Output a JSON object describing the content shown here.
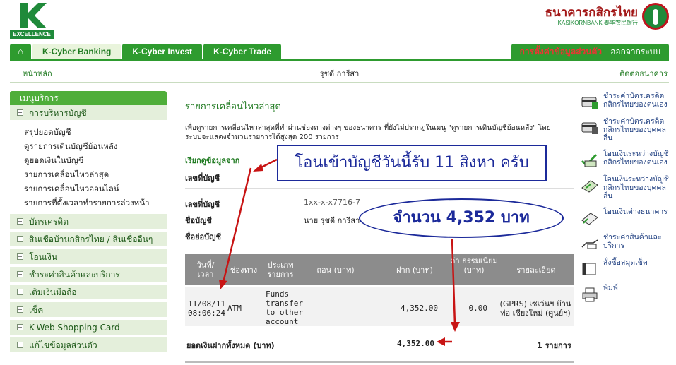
{
  "header": {
    "logo_text": "EXCELLENCE",
    "bank_name_thai": "ธนาคารกสิกรไทย",
    "bank_name_en": "KASIKORNBANK 泰华农民银行"
  },
  "tabs": [
    "K-Cyber Banking",
    "K-Cyber Invest",
    "K-Cyber Trade"
  ],
  "tab_right": {
    "settings": "การตั้งค่าข้อมูลส่วนตัว",
    "logout": "ออกจากระบบ"
  },
  "subnav": {
    "home": "หน้าหลัก",
    "user": "รุชดี การีสา",
    "contact": "ติดต่อธนาคาร"
  },
  "sidebar": {
    "title": "เมนูบริการ",
    "account_group": "การบริหารบัญชี",
    "account_items": [
      "สรุปยอดบัญชี",
      "ดูรายการเดินบัญชีย้อนหลัง",
      "ดูยอดเงินในบัญชี",
      "รายการเคลื่อนไหวล่าสุด",
      "รายการเคลื่อนไหวออนไลน์",
      "รายการที่ตั้งเวลาทำรายการล่วงหน้า"
    ],
    "groups": [
      "บัตรเครดิต",
      "สินเชื่อบ้านกสิกรไทย / สินเชื่ออื่นๆ",
      "โอนเงิน",
      "ชำระค่าสินค้าและบริการ",
      "เติมเงินมือถือ",
      "เช็ค",
      "K-Web Shopping Card",
      "แก้ไขข้อมูลส่วนตัว"
    ]
  },
  "main": {
    "title": "รายการเคลื่อนไหวล่าสุด",
    "desc": "เพื่อดูรายการเคลื่อนไหวล่าสุดที่ทำผ่านช่องทางต่างๆ ของธนาคาร ที่ยังไม่ปรากฏในเมนู \"ดูรายการเดินบัญชีย้อนหลัง\" โดยระบบจะแสดงจำนวนรายการได้สูงสุด 200 รายการ",
    "query_label": "เรียกดูข้อมูลจาก",
    "acct_label": "เลขที่บัญชี",
    "acct_label2": "เลขที่บัญชี",
    "acct_value": "1xx-x-x7716-7",
    "name_label": "ชื่อบัญชี",
    "name_value": "นาย รุชดี การีสา",
    "nickname_label": "ชื่อย่อบัญชี"
  },
  "table": {
    "headers": [
      "วันที่/ เวลา",
      "ช่องทาง",
      "ประเภท รายการ",
      "ถอน (บาท)",
      "ฝาก (บาท)",
      "ค่า ธรรมเนียม (บาท)",
      "รายละเอียด"
    ],
    "rows": [
      {
        "date": "11/08/11",
        "time": "08:06:24",
        "channel": "ATM",
        "type": "Funds transfer to other account",
        "withdraw": "",
        "deposit": "4,352.00",
        "fee": "0.00",
        "detail": "(GPRS) เซเว่นฯ บ้านท่อ เชียงใหม่ (ศูนย์ฯ)"
      }
    ],
    "total_label": "ยอดเงินฝากทั้งหมด (บาท)",
    "total_value": "4,352.00",
    "total_count": "1 รายการ"
  },
  "rightcol": [
    "ชำระค่าบัตรเครดิตกสิกรไทยของตนเอง",
    "ชำระค่าบัตรเครดิตกสิกรไทยของบุคคลอื่น",
    "โอนเงินระหว่างบัญชีกสิกรไทยของตนเอง",
    "โอนเงินระหว่างบัญชีกสิกรไทยของบุคคลอื่น",
    "โอนเงินต่างธนาคาร",
    "ชำระค่าสินค้าและบริการ",
    "สั่งซื้อสมุดเช็ค",
    "พิมพ์"
  ],
  "annotations": {
    "box": "โอนเข้าบัญชีวันนี้รับ 11 สิงหา ครับ",
    "oval": "จำนวน 4,352 บาท"
  },
  "colors": {
    "brand_green": "#2e9b2f",
    "annotation_blue": "#1c2a9a",
    "arrow_red": "#c81414"
  }
}
